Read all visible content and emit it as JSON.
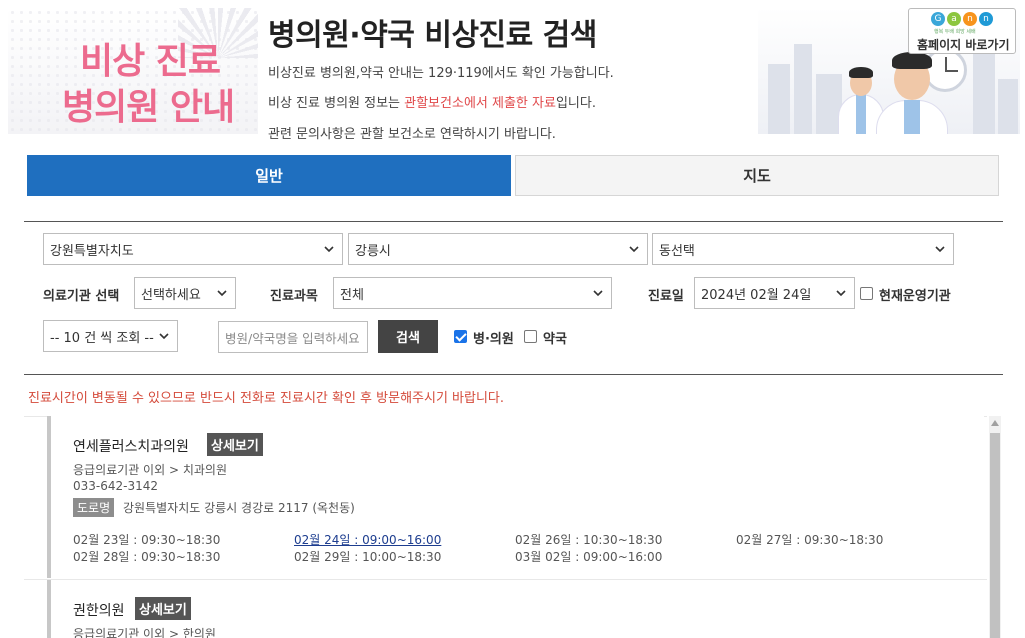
{
  "header": {
    "hero_line1": "비상 진료",
    "hero_line2": "병의원 안내",
    "title": "병의원·약국 비상진료 검색",
    "desc1": "비상진료 병의원,약국 안내는 129·119에서도 확인 가능합니다.",
    "desc2_pre": "비상 진료 병의원 정보는 ",
    "desc2_red": "관할보건소에서 제출한 자료",
    "desc2_post": "입니다.",
    "desc3": "관련 문의사항은 관할 보건소로 연락하시기 바랍니다.",
    "homepage_button": "홈페이지 바로가기",
    "logo_tagline": "행복 두배 희망 세배",
    "logo_letters": [
      "G",
      "a",
      "n",
      "n"
    ],
    "logo_colors": [
      "#3aa7d9",
      "#8cc63f",
      "#f7941d",
      "#1f9ad6"
    ]
  },
  "tabs": [
    {
      "label": "일반",
      "active": true
    },
    {
      "label": "지도",
      "active": false
    }
  ],
  "search": {
    "province": "강원특별자치도",
    "city": "강릉시",
    "dong": "동선택",
    "institution_label": "의료기관 선택",
    "institution_value": "선택하세요",
    "department_label": "진료과목",
    "department_value": "전체",
    "date_label": "진료일",
    "date_value": "2024년 02월 24일",
    "open_now_label": "현재운영기관",
    "open_now_checked": false,
    "page_size": "-- 10 건 씩 조회 --",
    "keyword_placeholder": "병원/약국명을 입력하세요",
    "search_button": "검색",
    "hospital_label": "병·의원",
    "hospital_checked": true,
    "pharmacy_label": "약국",
    "pharmacy_checked": false
  },
  "notice": "진료시간이 변동될 수 있으므로 반드시 전화로 진료시간 확인 후 방문해주시기 바랍니다.",
  "results": [
    {
      "name": "연세플러스치과의원",
      "detail_label": "상세보기",
      "category": "응급의료기관 이외 > 치과의원",
      "phone": "033-642-3142",
      "road_badge": "도로명",
      "address": "강원특별자치도 강릉시 경강로 2117 (옥천동)",
      "schedule": [
        {
          "text": "02월 23일 : 09:30~18:30",
          "today": false
        },
        {
          "text": "02월 24일 : 09:00~16:00",
          "today": true
        },
        {
          "text": "02월 26일 : 10:30~18:30",
          "today": false
        },
        {
          "text": "02월 27일 : 09:30~18:30",
          "today": false
        },
        {
          "text": "02월 28일 : 09:30~18:30",
          "today": false
        },
        {
          "text": "02월 29일 : 10:00~18:30",
          "today": false
        },
        {
          "text": "03월 02일 : 09:00~16:00",
          "today": false
        }
      ]
    },
    {
      "name": "권한의원",
      "detail_label": "상세보기",
      "category": "응급의료기관 이외 > 한의원"
    }
  ]
}
